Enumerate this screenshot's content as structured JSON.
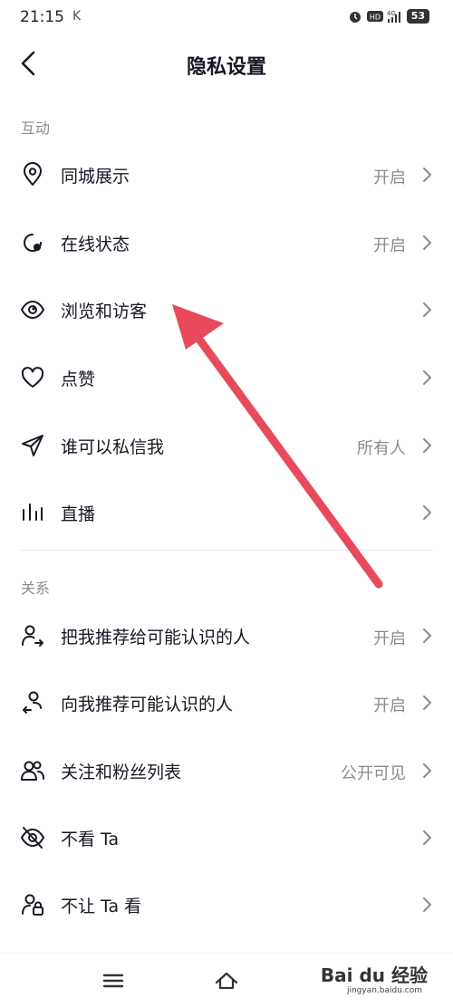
{
  "status_bar": {
    "time": "21:15",
    "extra": "K",
    "battery": "53"
  },
  "header": {
    "title": "隐私设置"
  },
  "sections": [
    {
      "label": "互动",
      "items": [
        {
          "label": "同城展示",
          "value": "开启",
          "icon": "location-pin-icon"
        },
        {
          "label": "在线状态",
          "value": "开启",
          "icon": "online-status-icon"
        },
        {
          "label": "浏览和访客",
          "value": "",
          "icon": "eye-icon"
        },
        {
          "label": "点赞",
          "value": "",
          "icon": "heart-icon"
        },
        {
          "label": "谁可以私信我",
          "value": "所有人",
          "icon": "paper-plane-icon"
        },
        {
          "label": "直播",
          "value": "",
          "icon": "live-bars-icon"
        }
      ]
    },
    {
      "label": "关系",
      "items": [
        {
          "label": "把我推荐给可能认识的人",
          "value": "开启",
          "icon": "user-share-icon"
        },
        {
          "label": "向我推荐可能认识的人",
          "value": "开启",
          "icon": "user-recommend-icon"
        },
        {
          "label": "关注和粉丝列表",
          "value": "公开可见",
          "icon": "users-icon"
        },
        {
          "label": "不看 Ta",
          "value": "",
          "icon": "eye-off-icon"
        },
        {
          "label": "不让 Ta 看",
          "value": "",
          "icon": "user-lock-icon"
        }
      ]
    }
  ],
  "watermark": {
    "brand": "Bai du 经验",
    "url": "jingyan.baidu.com"
  },
  "colors": {
    "text": "#161823",
    "secondary": "#8a8b91",
    "annotation_arrow": "#e8495b"
  }
}
